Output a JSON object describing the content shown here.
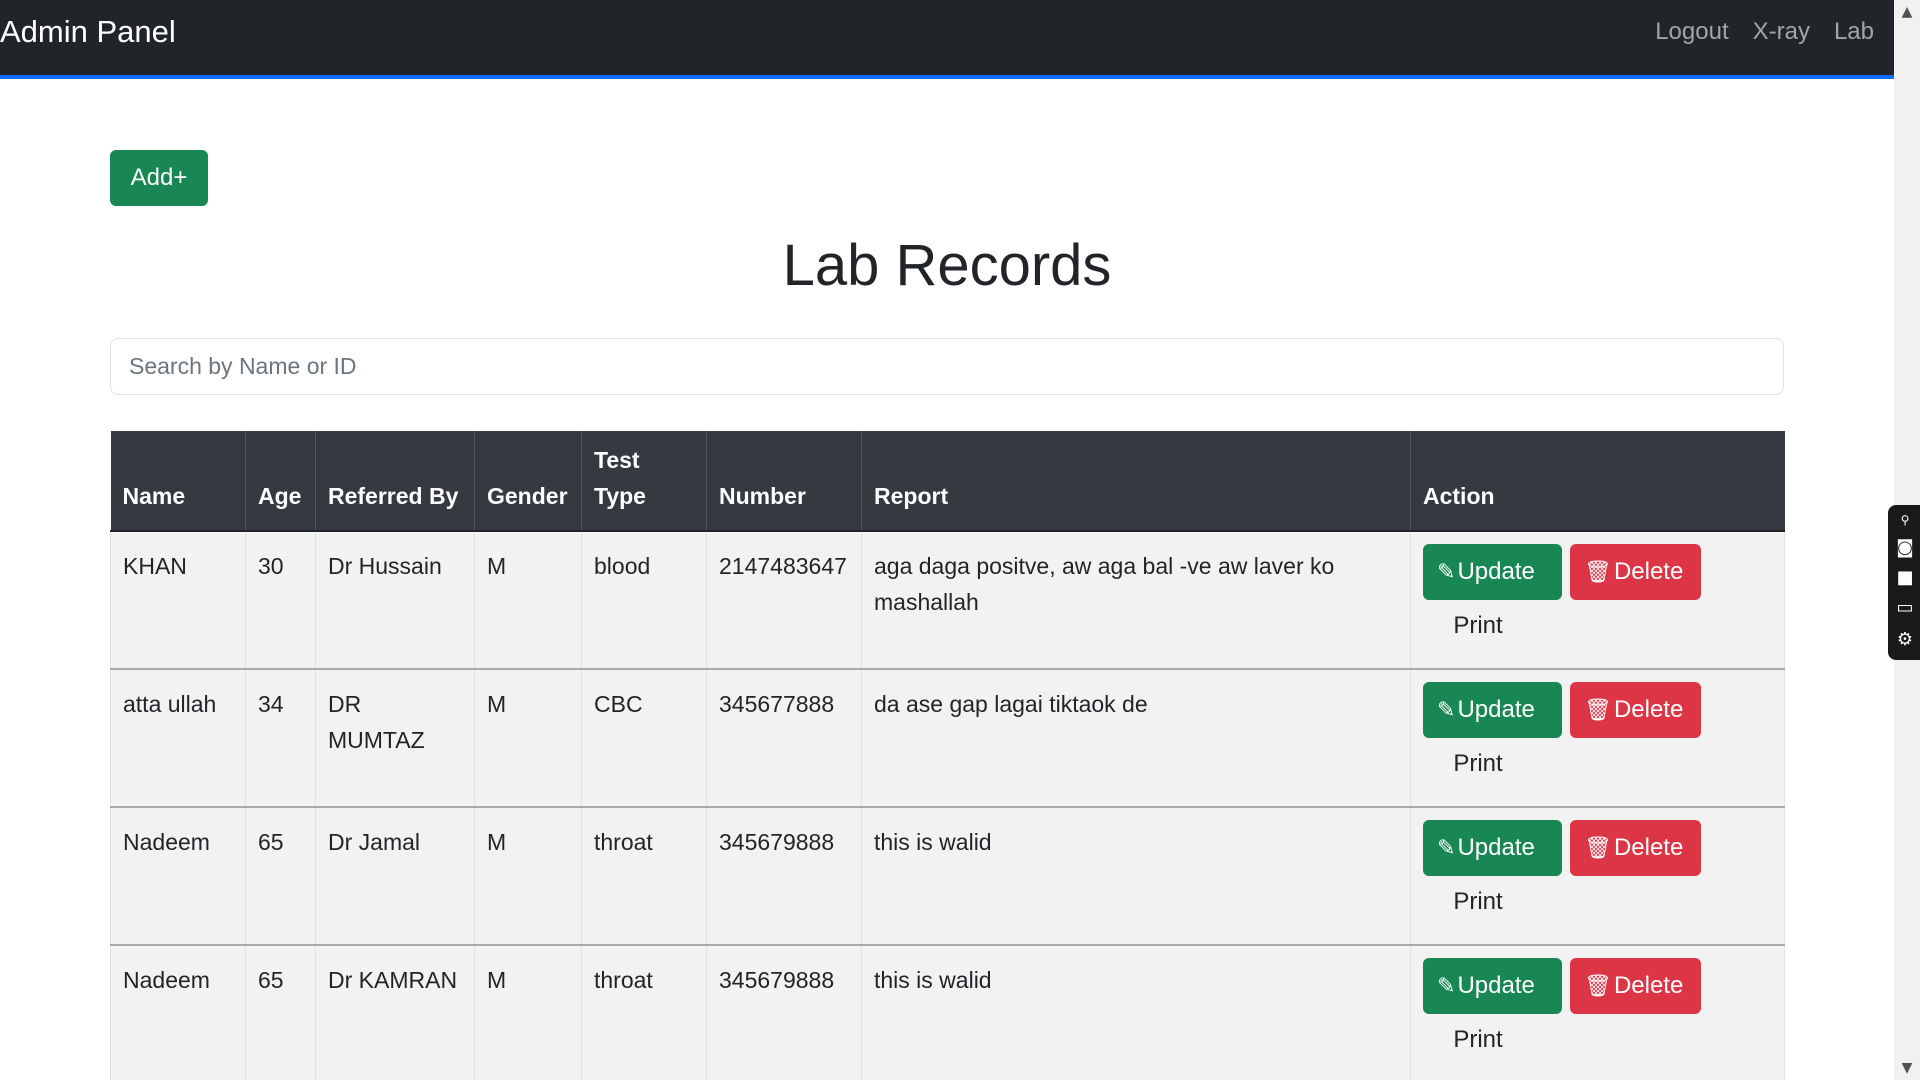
{
  "navbar": {
    "brand": "Admin Panel",
    "links": [
      "Logout",
      "X-ray",
      "Lab"
    ]
  },
  "add_label": "Add+",
  "title": "Lab Records",
  "search": {
    "placeholder": "Search by Name or ID",
    "value": ""
  },
  "table": {
    "headers": [
      "Name",
      "Age",
      "Referred By",
      "Gender",
      "Test Type",
      "Number",
      "Report",
      "Action"
    ],
    "rows": [
      {
        "name": "KHAN",
        "age": "30",
        "referred_by": "Dr Hussain",
        "gender": "M",
        "test_type": "blood",
        "number": "2147483647",
        "report": "aga daga positve, aw aga bal -ve aw laver ko mashallah"
      },
      {
        "name": "atta ullah",
        "age": "34",
        "referred_by": "DR MUMTAZ",
        "gender": "M",
        "test_type": "CBC",
        "number": "345677888",
        "report": "da ase gap lagai tiktaok de"
      },
      {
        "name": "Nadeem",
        "age": "65",
        "referred_by": "Dr Jamal",
        "gender": "M",
        "test_type": "throat",
        "number": "345679888",
        "report": "this is walid"
      },
      {
        "name": "Nadeem",
        "age": "65",
        "referred_by": "Dr KAMRAN",
        "gender": "M",
        "test_type": "throat",
        "number": "345679888",
        "report": "this is walid"
      }
    ],
    "actions": {
      "update": "Update",
      "delete": "Delete",
      "print": "Print"
    }
  },
  "icons": {
    "update": "pencil-icon",
    "delete": "trash-icon"
  },
  "colors": {
    "navbar": "#212529",
    "accent": "#0d6efd",
    "success": "#198754",
    "danger": "#dc3545",
    "header": "#343a40"
  }
}
